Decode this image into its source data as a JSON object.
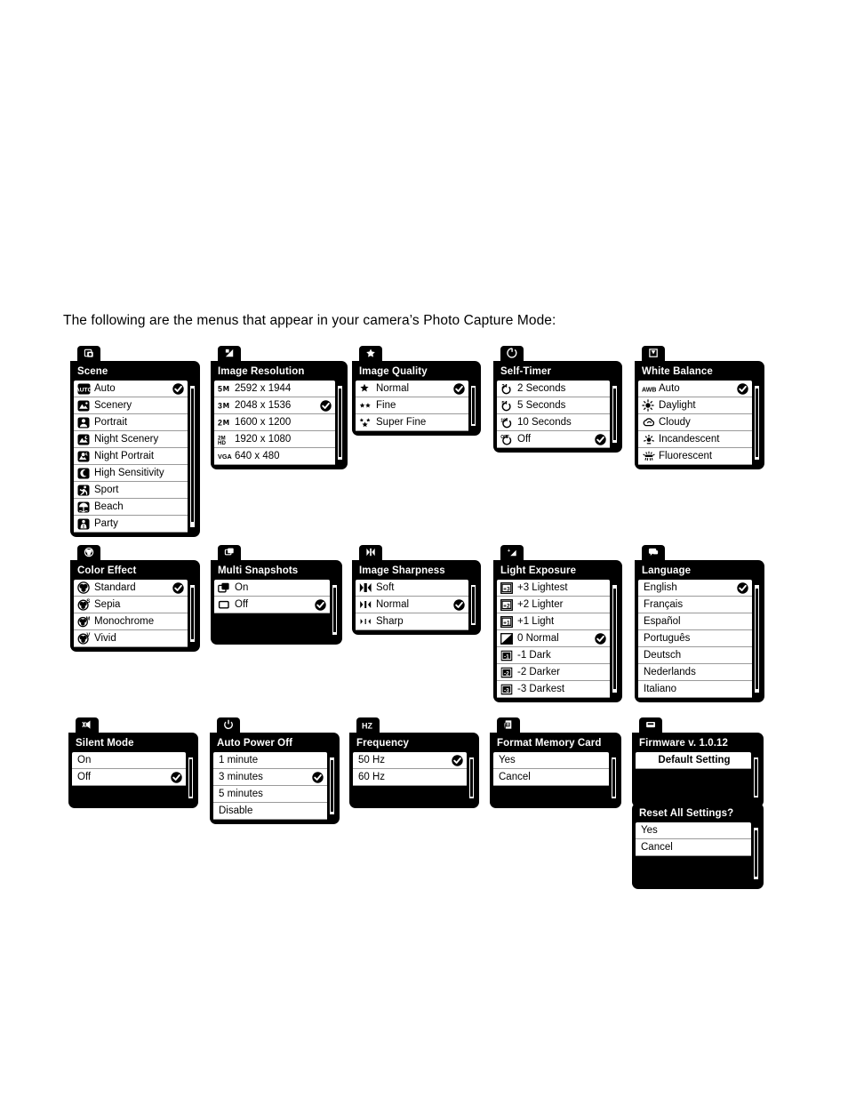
{
  "intro": "The following are the menus that appear in your camera’s Photo Capture Mode:",
  "menus": [
    {
      "id": "scene",
      "tab_icon": "scene-icon",
      "title": "Scene",
      "items": [
        {
          "label": "Auto",
          "icon": "auto-scene-icon",
          "checked": true
        },
        {
          "label": "Scenery",
          "icon": "scenery-icon",
          "checked": false
        },
        {
          "label": "Portrait",
          "icon": "portrait-icon",
          "checked": false
        },
        {
          "label": "Night Scenery",
          "icon": "night-scenery-icon",
          "checked": false
        },
        {
          "label": "Night Portrait",
          "icon": "night-portrait-icon",
          "checked": false
        },
        {
          "label": "High Sensitivity",
          "icon": "high-sensitivity-icon",
          "checked": false
        },
        {
          "label": "Sport",
          "icon": "sport-icon",
          "checked": false
        },
        {
          "label": "Beach",
          "icon": "beach-icon",
          "checked": false
        },
        {
          "label": "Party",
          "icon": "party-icon",
          "checked": false
        }
      ]
    },
    {
      "id": "image-resolution",
      "tab_icon": "resolution-icon",
      "title": "Image Resolution",
      "items": [
        {
          "label": "2592 x 1944",
          "icon": "5m-icon",
          "badge": "5M",
          "checked": false
        },
        {
          "label": "2048 x 1536",
          "icon": "3m-icon",
          "badge": "3M",
          "checked": true
        },
        {
          "label": "1600 x 1200",
          "icon": "2m-icon",
          "badge": "2M",
          "checked": false
        },
        {
          "label": "1920 x 1080",
          "icon": "2m-hd-icon",
          "badge": "2M HD",
          "checked": false
        },
        {
          "label": "640 x 480",
          "icon": "vga-icon",
          "badge": "VGA",
          "checked": false
        }
      ]
    },
    {
      "id": "image-quality",
      "tab_icon": "star-icon",
      "title": "Image Quality",
      "items": [
        {
          "label": "Normal",
          "icon": "one-star-icon",
          "checked": true
        },
        {
          "label": "Fine",
          "icon": "two-star-icon",
          "checked": false
        },
        {
          "label": "Super Fine",
          "icon": "three-star-icon",
          "checked": false
        }
      ]
    },
    {
      "id": "self-timer",
      "tab_icon": "timer-icon",
      "title": "Self-Timer",
      "items": [
        {
          "label": "2 Seconds",
          "icon": "timer-2s-icon",
          "checked": false
        },
        {
          "label": "5 Seconds",
          "icon": "timer-5s-icon",
          "checked": false
        },
        {
          "label": "10 Seconds",
          "icon": "timer-10s-icon",
          "checked": false
        },
        {
          "label": "Off",
          "icon": "timer-off-icon",
          "checked": true
        }
      ]
    },
    {
      "id": "white-balance",
      "tab_icon": "white-balance-icon",
      "title": "White Balance",
      "items": [
        {
          "label": "Auto",
          "icon": "awb-icon",
          "checked": true
        },
        {
          "label": "Daylight",
          "icon": "daylight-icon",
          "checked": false
        },
        {
          "label": "Cloudy",
          "icon": "cloudy-icon",
          "checked": false
        },
        {
          "label": "Incandescent",
          "icon": "incandescent-icon",
          "checked": false
        },
        {
          "label": "Fluorescent",
          "icon": "fluorescent-icon",
          "checked": false
        }
      ]
    },
    {
      "id": "color-effect",
      "tab_icon": "color-effect-icon",
      "title": "Color Effect",
      "items": [
        {
          "label": "Standard",
          "icon": "standard-color-icon",
          "checked": true
        },
        {
          "label": "Sepia",
          "icon": "sepia-icon",
          "checked": false
        },
        {
          "label": "Monochrome",
          "icon": "monochrome-icon",
          "checked": false
        },
        {
          "label": "Vivid",
          "icon": "vivid-icon",
          "checked": false
        }
      ]
    },
    {
      "id": "multi-snapshots",
      "tab_icon": "multi-snapshots-icon",
      "title": "Multi Snapshots",
      "items": [
        {
          "label": "On",
          "icon": "stack-icon",
          "checked": false
        },
        {
          "label": "Off",
          "icon": "single-frame-icon",
          "checked": true
        }
      ]
    },
    {
      "id": "image-sharpness",
      "tab_icon": "sharpness-icon",
      "title": "Image Sharpness",
      "items": [
        {
          "label": "Soft",
          "icon": "soft-icon",
          "checked": false
        },
        {
          "label": "Normal",
          "icon": "normal-sharpness-icon",
          "checked": true
        },
        {
          "label": "Sharp",
          "icon": "sharp-icon",
          "checked": false
        }
      ]
    },
    {
      "id": "light-exposure",
      "tab_icon": "exposure-icon",
      "title": "Light Exposure",
      "items": [
        {
          "label": "+3 Lightest",
          "icon": "ev-plus3-icon",
          "badge": "+3",
          "checked": false
        },
        {
          "label": "+2 Lighter",
          "icon": "ev-plus2-icon",
          "badge": "+2",
          "checked": false
        },
        {
          "label": "+1 Light",
          "icon": "ev-plus1-icon",
          "badge": "+1",
          "checked": false
        },
        {
          "label": "0 Normal",
          "icon": "ev-zero-icon",
          "badge": "",
          "checked": true
        },
        {
          "label": "-1 Dark",
          "icon": "ev-minus1-icon",
          "badge": "-1",
          "checked": false
        },
        {
          "label": "-2 Darker",
          "icon": "ev-minus2-icon",
          "badge": "-2",
          "checked": false
        },
        {
          "label": "-3 Darkest",
          "icon": "ev-minus3-icon",
          "badge": "-3",
          "checked": false
        }
      ]
    },
    {
      "id": "language",
      "tab_icon": "language-icon",
      "title": "Language",
      "items": [
        {
          "label": "English",
          "icon": "",
          "checked": true
        },
        {
          "label": "Français",
          "icon": "",
          "checked": false
        },
        {
          "label": "Español",
          "icon": "",
          "checked": false
        },
        {
          "label": "Português",
          "icon": "",
          "checked": false
        },
        {
          "label": "Deutsch",
          "icon": "",
          "checked": false
        },
        {
          "label": "Nederlands",
          "icon": "",
          "checked": false
        },
        {
          "label": "Italiano",
          "icon": "",
          "checked": false
        }
      ]
    },
    {
      "id": "silent-mode",
      "tab_icon": "mute-icon",
      "title": "Silent Mode",
      "items": [
        {
          "label": "On",
          "icon": "",
          "checked": false
        },
        {
          "label": "Off",
          "icon": "",
          "checked": true
        }
      ]
    },
    {
      "id": "auto-power-off",
      "tab_icon": "power-icon",
      "title": "Auto Power Off",
      "items": [
        {
          "label": "1 minute",
          "icon": "",
          "checked": false
        },
        {
          "label": "3 minutes",
          "icon": "",
          "checked": true
        },
        {
          "label": "5 minutes",
          "icon": "",
          "checked": false
        },
        {
          "label": "Disable",
          "icon": "",
          "checked": false
        }
      ]
    },
    {
      "id": "frequency",
      "tab_icon": "hz-icon",
      "title": "Frequency",
      "items": [
        {
          "label": "50 Hz",
          "icon": "",
          "checked": true
        },
        {
          "label": "60 Hz",
          "icon": "",
          "checked": false
        }
      ]
    },
    {
      "id": "format-memory-card",
      "tab_icon": "memory-card-icon",
      "title": "Format Memory Card",
      "items": [
        {
          "label": "Yes",
          "icon": "",
          "checked": false
        },
        {
          "label": "Cancel",
          "icon": "",
          "checked": false
        }
      ]
    },
    {
      "id": "firmware",
      "tab_icon": "firmware-icon",
      "title": "Firmware v. 1.0.12",
      "items": [
        {
          "label": "Default Setting",
          "icon": "",
          "checked": false,
          "center": true
        }
      ]
    },
    {
      "id": "reset-all-settings",
      "tab_icon": "",
      "title": "Reset All Settings?",
      "items": [
        {
          "label": "Yes",
          "icon": "",
          "checked": false
        },
        {
          "label": "Cancel",
          "icon": "",
          "checked": false
        }
      ]
    }
  ]
}
